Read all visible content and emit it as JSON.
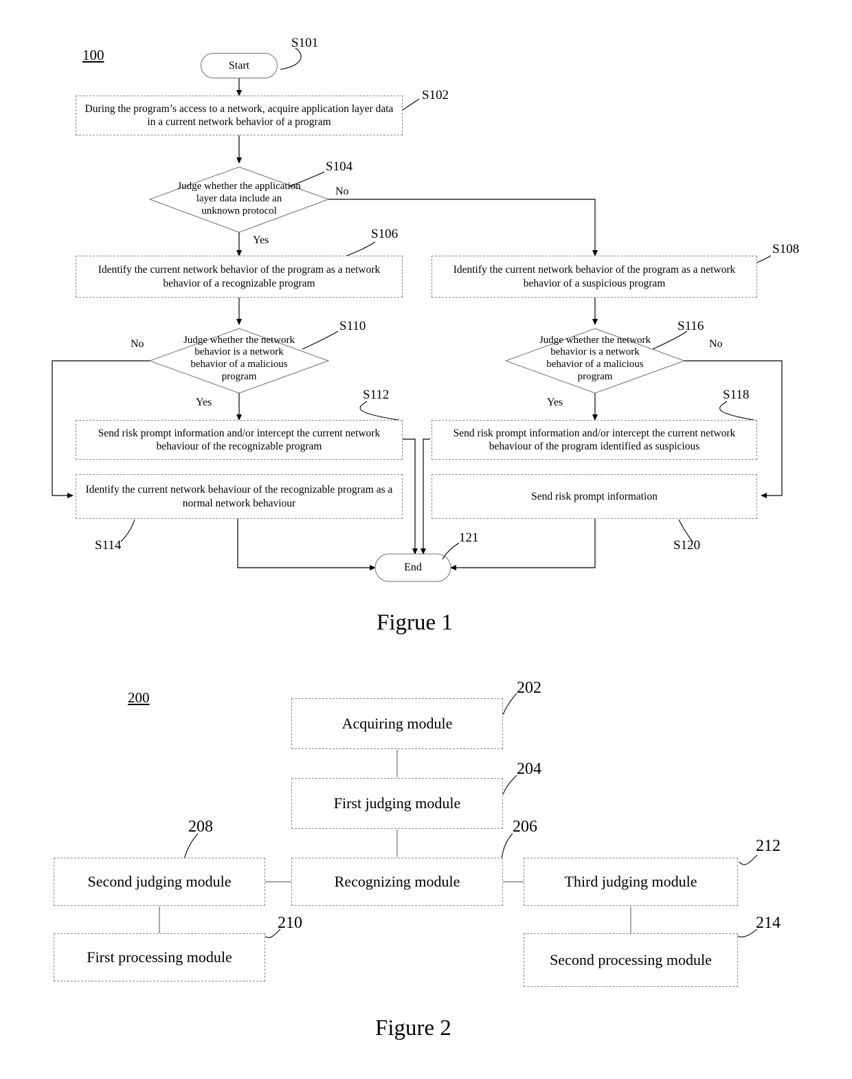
{
  "figure1": {
    "ref_number": "100",
    "caption": "Figrue 1",
    "nodes": {
      "start": {
        "label": "Start",
        "ref": "S101"
      },
      "s102": {
        "label": "During the program’s access to a network, acquire application layer data in a current network behavior of a program",
        "ref": "S102"
      },
      "s104": {
        "label": "Judge whether the application layer data include an unknown protocol",
        "ref": "S104"
      },
      "s106": {
        "label": "Identify the current network behavior of the program as a network behavior of a recognizable program",
        "ref": "S106"
      },
      "s108": {
        "label": "Identify the current network behavior of the program as a network behavior of a suspicious program",
        "ref": "S108"
      },
      "s110": {
        "label": "Judge whether the network behavior is a network behavior of a malicious program",
        "ref": "S110"
      },
      "s116": {
        "label": "Judge whether the network behavior is a network behavior of a malicious program",
        "ref": "S116"
      },
      "s112": {
        "label": "Send risk prompt information and/or intercept the current network behaviour of the recognizable program",
        "ref": "S112"
      },
      "s118": {
        "label": "Send risk prompt information and/or intercept the current network behaviour of the program identified as suspicious",
        "ref": "S118"
      },
      "s114": {
        "label": "Identify the current network behaviour of the recognizable program as a normal network behaviour",
        "ref": "S114"
      },
      "s120": {
        "label": "Send risk prompt information",
        "ref": "S120"
      },
      "end": {
        "label": "End",
        "ref": "121"
      }
    },
    "edge_labels": {
      "s104_no": "No",
      "s104_yes": "Yes",
      "s110_no": "No",
      "s110_yes": "Yes",
      "s116_no": "No",
      "s116_yes": "Yes"
    }
  },
  "figure2": {
    "ref_number": "200",
    "caption": "Figure 2",
    "nodes": {
      "acquiring": {
        "label": "Acquiring module",
        "ref": "202"
      },
      "first_judging": {
        "label": "First judging module",
        "ref": "204"
      },
      "recognizing": {
        "label": "Recognizing module",
        "ref": "206"
      },
      "second_judging": {
        "label": "Second judging module",
        "ref": "208"
      },
      "first_processing": {
        "label": "First processing module",
        "ref": "210"
      },
      "third_judging": {
        "label": "Third judging module",
        "ref": "212"
      },
      "second_processing": {
        "label": "Second processing module",
        "ref": "214"
      }
    }
  }
}
